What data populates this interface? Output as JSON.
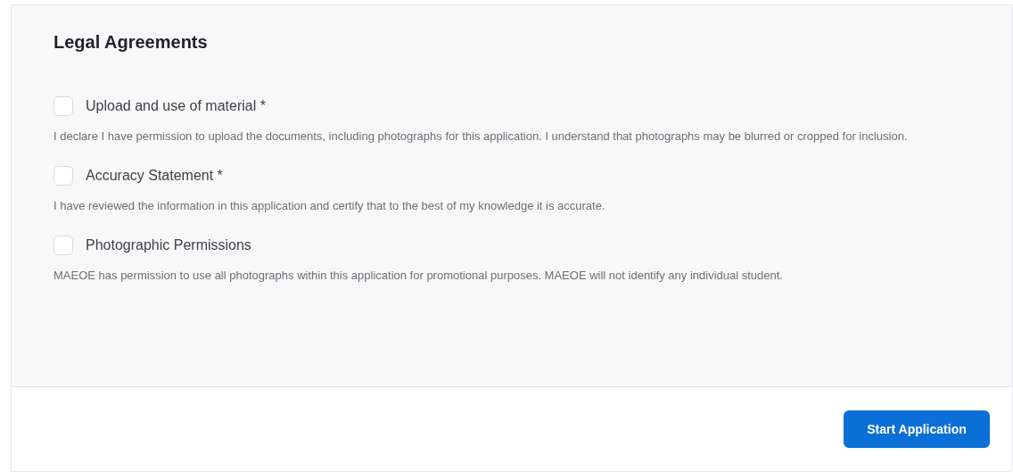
{
  "section": {
    "title": "Legal Agreements"
  },
  "agreements": [
    {
      "label": "Upload and use of material *",
      "checked": false,
      "description": "I declare I have permission to upload the documents, including photographs for this application. I understand that photographs may be blurred or cropped for inclusion."
    },
    {
      "label": "Accuracy Statement *",
      "checked": false,
      "description": "I have reviewed the information in this application and certify that to the best of my knowledge it is accurate."
    },
    {
      "label": "Photographic Permissions",
      "checked": false,
      "description": "MAEOE has permission to use all photographs within this application for promotional purposes. MAEOE will not identify any individual student."
    }
  ],
  "footer": {
    "button": "Start Application"
  }
}
